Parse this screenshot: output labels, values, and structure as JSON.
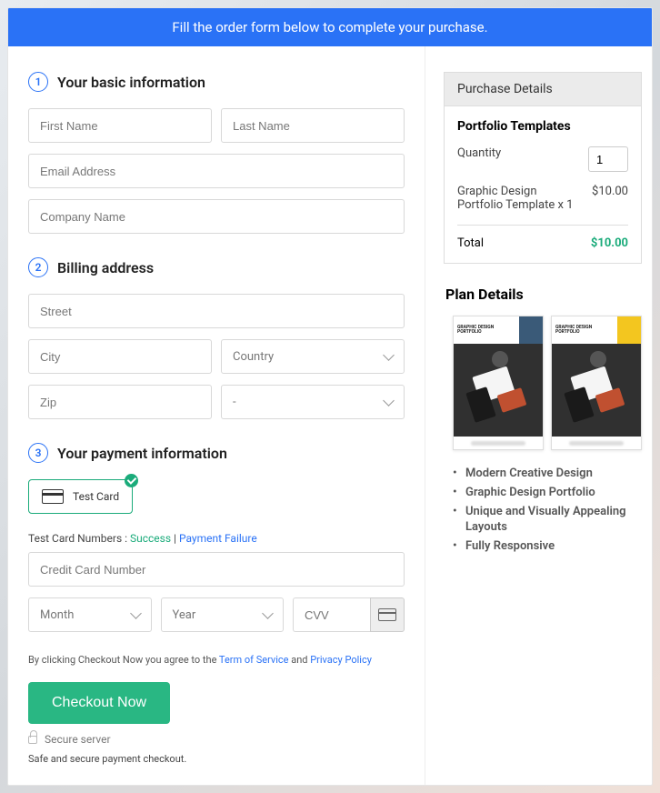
{
  "banner": "Fill the order form below to complete your purchase.",
  "sections": {
    "s1": {
      "num": "1",
      "label": "Your basic information"
    },
    "s2": {
      "num": "2",
      "label": "Billing address"
    },
    "s3": {
      "num": "3",
      "label": "Your payment information"
    }
  },
  "form": {
    "first_name": "First Name",
    "last_name": "Last Name",
    "email": "Email Address",
    "company": "Company Name",
    "street": "Street",
    "city": "City",
    "country": "Country",
    "zip": "Zip",
    "state": "-",
    "test_card": "Test  Card",
    "test_numbers_label": "Test Card Numbers : ",
    "success": "Success",
    "sep": " | ",
    "failure": "Payment Failure",
    "cc_number": "Credit Card Number",
    "month": "Month",
    "year": "Year",
    "cvv": "CVV"
  },
  "terms": {
    "prefix": "By clicking Checkout Now you agree to the ",
    "tos": "Term of Service",
    "and": " and ",
    "pp": "Privacy Policy"
  },
  "checkout_label": "Checkout Now",
  "secure_server": "Secure server",
  "safe_note": "Safe and secure payment checkout.",
  "purchase": {
    "header": "Purchase Details",
    "product": "Portfolio Templates",
    "quantity_label": "Quantity",
    "quantity_value": "1",
    "line_item": "Graphic Design Portfolio Template x 1",
    "line_price": "$10.00",
    "total_label": "Total",
    "total_value": "$10.00"
  },
  "plan": {
    "title": "Plan Details",
    "thumb_label": "GRAPHIC DESIGN PORTFOLIO",
    "accent_a": "#3a5a78",
    "accent_b": "#f3c61f",
    "features": [
      "Modern Creative Design",
      "Graphic Design Portfolio",
      "Unique and Visually Appealing Layouts",
      "Fully Responsive"
    ]
  }
}
